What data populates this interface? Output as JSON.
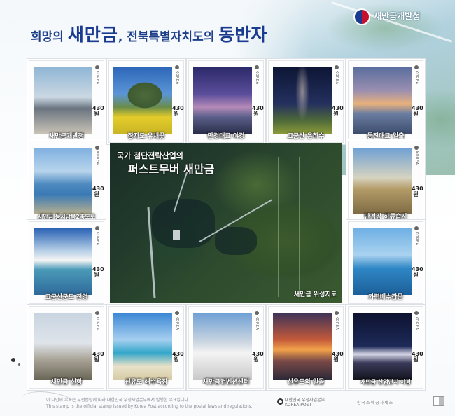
{
  "header": {
    "title_a": "희망의 ",
    "title_b": "새만금",
    "title_c": ", 전북특별자치도의 ",
    "title_d": "동반자",
    "org_logo": "taegeuk-logo-icon",
    "org_name": "새만금개발청"
  },
  "stamps": [
    {
      "caption": "새만금개발청",
      "side": "KOREA",
      "price": "430원"
    },
    {
      "caption": "장자도 유채꽃",
      "side": "KOREA",
      "price": "430원"
    },
    {
      "caption": "만경대교 야경",
      "side": "KOREA",
      "price": "430원"
    },
    {
      "caption": "고군산 은하수",
      "side": "KOREA",
      "price": "430원"
    },
    {
      "caption": "동진대교 일출",
      "side": "KOREA",
      "price": "430원"
    },
    {
      "caption": "새만금 동서남북2축도로",
      "side": "KOREA",
      "price": "430원"
    },
    {
      "caption": "만경강 하류습지",
      "side": "KOREA",
      "price": "430원"
    },
    {
      "caption": "고군산군도 전경",
      "side": "KOREA",
      "price": "430원"
    },
    {
      "caption": "가력배수갑문",
      "side": "KOREA",
      "price": "430원"
    },
    {
      "caption": "새만금 신항",
      "side": "KOREA",
      "price": "430원"
    },
    {
      "caption": "선유도 해수욕장",
      "side": "KOREA",
      "price": "430원"
    },
    {
      "caption": "새만금컨벤션센터",
      "side": "KOREA",
      "price": "430원"
    },
    {
      "caption": "선유도의 일몰",
      "side": "KOREA",
      "price": "430원"
    },
    {
      "caption": "새만금 산업단지 야경",
      "side": "KOREA",
      "price": "430원"
    }
  ],
  "center": {
    "line1": "국가 첨단전략산업의",
    "line2": "퍼스트무버 새만금",
    "caption": "새만금 위성지도"
  },
  "footer": {
    "note_ko": "이 나만의 우표는 우편법령에 따라 대한민국 우정사업본부에서 발행한 우표입니다.",
    "note_en": "This stamp is the official stamp issued by Korea Post according to the postal laws and regulations.",
    "post_ko": "대한민국 우정사업본부",
    "post_en": "KOREA POST",
    "printer": "한국조폐공사제조"
  }
}
